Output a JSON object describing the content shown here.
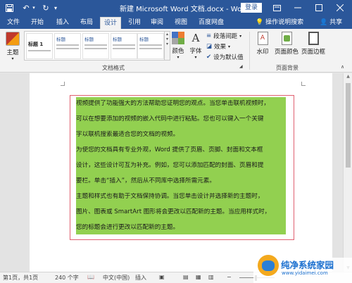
{
  "window": {
    "title": "新建 Microsoft Word 文档.docx  -  Word",
    "login_label": "登录"
  },
  "tabs": [
    {
      "label": "文件"
    },
    {
      "label": "开始"
    },
    {
      "label": "插入"
    },
    {
      "label": "布局"
    },
    {
      "label": "设计"
    },
    {
      "label": "引用"
    },
    {
      "label": "审阅"
    },
    {
      "label": "视图"
    },
    {
      "label": "百度网盘"
    }
  ],
  "tell_me": "操作说明搜索",
  "share_label": "共享",
  "ribbon": {
    "theme_label": "主题",
    "styles": [
      "标题",
      "标题",
      "标题",
      "标题 1",
      "标题"
    ],
    "styles_first": "标题 1",
    "colors_label": "颜色",
    "fonts_label": "字体",
    "para_spacing_label": "段落间距",
    "effects_label": "效果",
    "set_default_label": "设为默认值",
    "doc_format_group": "文档格式",
    "watermark_label": "水印",
    "page_color_label": "页面颜色",
    "page_border_label": "页面边框",
    "page_bg_group": "页面背景"
  },
  "document": {
    "lines": [
      "视频提供了功能强大的方法帮助您证明您的观点。当您单击联机视频时，",
      "可以在想要添加的视频的嵌入代码中进行粘贴。您也可以键入一个关键",
      "字以联机搜索最适合您的文档的视频。",
      "为使您的文档具有专业外观，Word 提供了页眉、页脚、封面和文本框",
      "设计，这些设计可互为补充。例如，您可以添加匹配的封面、页眉和提",
      "要栏。单击“插入”，然后从不同库中选择所需元素。",
      "主题和样式也有助于文档保持协调。当您单击设计并选择新的主题时，",
      "图片、图表或 SmartArt 图形将会更改以匹配新的主题。当应用样式时，",
      "您的标题会进行更改以匹配新的主题。"
    ],
    "highlight_color": "#92d050",
    "textbox_border_color": "#e06070"
  },
  "status": {
    "page": "第1页，共1页",
    "words": "240 个字",
    "lang": "中文(中国)",
    "mode": "插入"
  },
  "watermark_logo": {
    "name": "纯净系统家园",
    "url": "www.yidaimei.com"
  },
  "colors": {
    "brand": "#2b579a",
    "highlight": "#92d050"
  }
}
